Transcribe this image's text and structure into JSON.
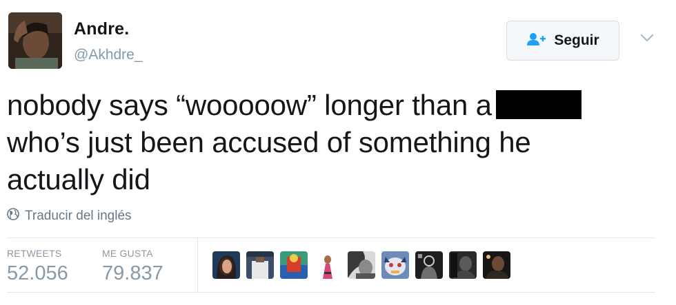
{
  "user": {
    "display_name": "Andre.",
    "screen_name": "@Akhdre_"
  },
  "follow_button": {
    "label": "Seguir",
    "icon": "add-user-icon"
  },
  "menu": {
    "icon": "chevron-down-icon"
  },
  "tweet": {
    "line1": "nobody says “wooooow” longer than a",
    "line2": "who’s just been accused of something he",
    "line3": "actually did"
  },
  "translate": {
    "label": "Traducir del inglés",
    "icon": "globe-icon"
  },
  "stats": {
    "retweets_label": "RETWEETS",
    "retweets_value": "52.056",
    "likes_label": "ME GUSTA",
    "likes_value": "79.837"
  },
  "likers": {
    "count": 9
  },
  "colors": {
    "text": "#14171a",
    "muted": "#8899a6",
    "accent": "#1da1f2",
    "button_bg": "#f5f8fa",
    "border": "#e1e8ed"
  }
}
